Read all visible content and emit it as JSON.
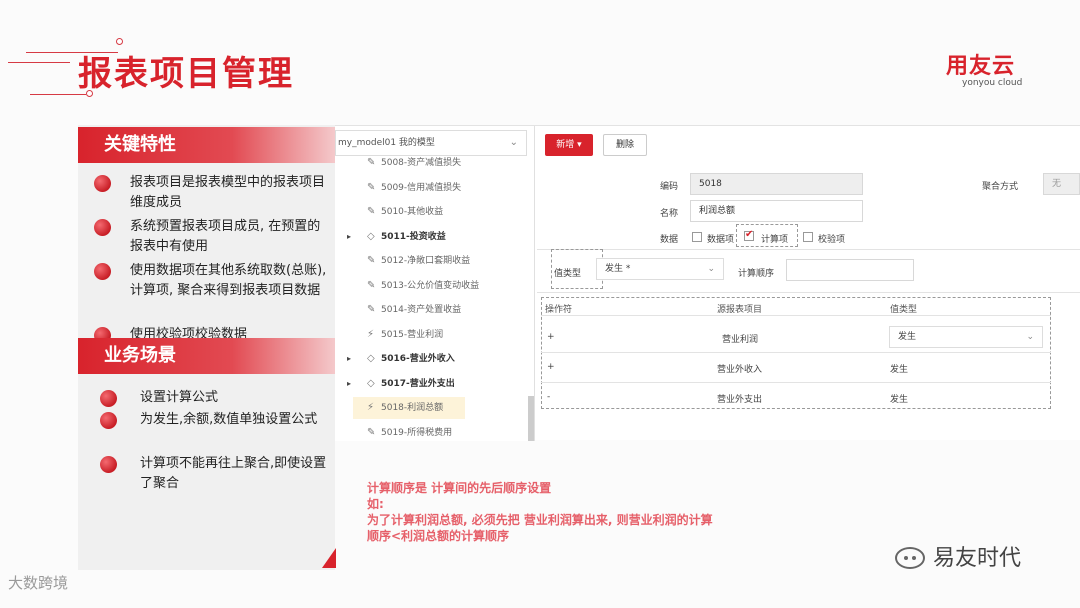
{
  "title": "报表项目管理",
  "logo": {
    "main": "用友云",
    "sub": "yonyou cloud"
  },
  "features": {
    "heading": "关键特性",
    "items": [
      "报表项目是报表模型中的报表项目维度成员",
      "系统预置报表项目成员, 在预置的报表中有使用",
      "使用数据项在其他系统取数(总账), 计算项, 聚合来得到报表项目数据",
      "使用校验项校验数据"
    ]
  },
  "scenarios": {
    "heading": "业务场景",
    "items": [
      "设置计算公式",
      "为发生,余额,数值单独设置公式",
      "计算项不能再往上聚合,即使设置了聚合"
    ]
  },
  "tree": {
    "model_select": "my_model01 我的模型",
    "items": [
      {
        "code": "5008-资产减值损失",
        "bold": false,
        "expand": false,
        "icon": "edit"
      },
      {
        "code": "5009-信用减值损失",
        "bold": false,
        "expand": false,
        "icon": "edit"
      },
      {
        "code": "5010-其他收益",
        "bold": false,
        "expand": false,
        "icon": "edit"
      },
      {
        "code": "5011-投资收益",
        "bold": true,
        "expand": true,
        "icon": "tag"
      },
      {
        "code": "5012-净敞口套期收益",
        "bold": false,
        "expand": false,
        "icon": "edit"
      },
      {
        "code": "5013-公允价值变动收益",
        "bold": false,
        "expand": false,
        "icon": "edit"
      },
      {
        "code": "5014-资产处置收益",
        "bold": false,
        "expand": false,
        "icon": "edit"
      },
      {
        "code": "5015-营业利润",
        "bold": false,
        "expand": false,
        "icon": "calc"
      },
      {
        "code": "5016-营业外收入",
        "bold": true,
        "expand": true,
        "icon": "tag"
      },
      {
        "code": "5017-营业外支出",
        "bold": true,
        "expand": true,
        "icon": "tag"
      },
      {
        "code": "5018-利润总额",
        "bold": false,
        "expand": false,
        "icon": "calc",
        "selected": true
      },
      {
        "code": "5019-所得税费用",
        "bold": false,
        "expand": false,
        "icon": "edit"
      }
    ]
  },
  "form": {
    "new_button": "新增",
    "delete_button": "删除",
    "code_label": "编码",
    "code_value": "5018",
    "name_label": "名称",
    "name_value": "利润总额",
    "data_label": "数据",
    "option_data": "数据项",
    "option_calc": "计算项",
    "option_check": "校验项",
    "agg_label": "聚合方式",
    "agg_value": "无",
    "value_type_label": "值类型",
    "value_type_value": "发生",
    "calc_order_label": "计算顺序",
    "calc_order_value": ""
  },
  "table": {
    "headers": [
      "操作符",
      "源报表项目",
      "值类型"
    ],
    "rows": [
      {
        "op": "+",
        "item": "营业利润",
        "type": "发生"
      },
      {
        "op": "+",
        "item": "营业外收入",
        "type": "发生"
      },
      {
        "op": "-",
        "item": "营业外支出",
        "type": "发生"
      }
    ]
  },
  "note": [
    "计算顺序是 计算间的先后顺序设置",
    "如:",
    "为了计算利润总额, 必须先把 营业利润算出来, 则营业利润的计算",
    "顺序<利润总额的计算顺序"
  ],
  "watermark_left": "大数跨境",
  "watermark_right": "易友时代",
  "colors": {
    "brand": "#d8232c",
    "note": "#e6606a"
  }
}
